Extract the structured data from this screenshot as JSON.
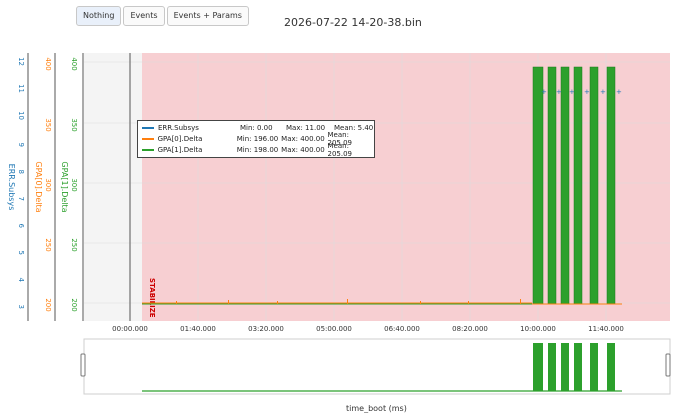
{
  "toolbar": {
    "buttons": [
      {
        "label": "Nothing",
        "active": true
      },
      {
        "label": "Events",
        "active": false
      },
      {
        "label": "Events + Params",
        "active": false
      }
    ]
  },
  "title": "2026-07-22 14-20-38.bin",
  "marker_label": "STABILIZE",
  "axes": {
    "err": {
      "label": "ERR.Subsys",
      "ticks": [
        "12",
        "11",
        "10",
        "9",
        "8",
        "7",
        "6",
        "5",
        "4",
        "3"
      ],
      "color": "#1f77b4"
    },
    "gpa0": {
      "label": "GPA[0].Delta",
      "ticks": [
        "400",
        "350",
        "300",
        "250",
        "200"
      ],
      "color": "#ff7f0e"
    },
    "gpa1": {
      "label": "GPA[1].Delta",
      "ticks": [
        "400",
        "350",
        "300",
        "250",
        "200"
      ],
      "color": "#2ca02c"
    },
    "x": {
      "label": "time_boot (ms)",
      "ticks": [
        "00:00.000",
        "01:40.000",
        "03:20.000",
        "05:00.000",
        "06:40.000",
        "08:20.000",
        "10:00.000",
        "11:40.000"
      ]
    }
  },
  "legend": [
    {
      "name": "ERR.Subsys",
      "min": "Min: 0.00",
      "max": "Max: 11.00",
      "mean": "Mean: 5.40",
      "color": "#1f77b4"
    },
    {
      "name": "GPA[0].Delta",
      "min": "Min: 196.00",
      "max": "Max: 400.00",
      "mean": "Mean: 205.09",
      "color": "#ff7f0e"
    },
    {
      "name": "GPA[1].Delta",
      "min": "Min: 198.00",
      "max": "Max: 400.00",
      "mean": "Mean: 205.09",
      "color": "#2ca02c"
    }
  ],
  "colors": {
    "mode_region": "#f7cfd2",
    "marker": "#cc0000"
  }
}
